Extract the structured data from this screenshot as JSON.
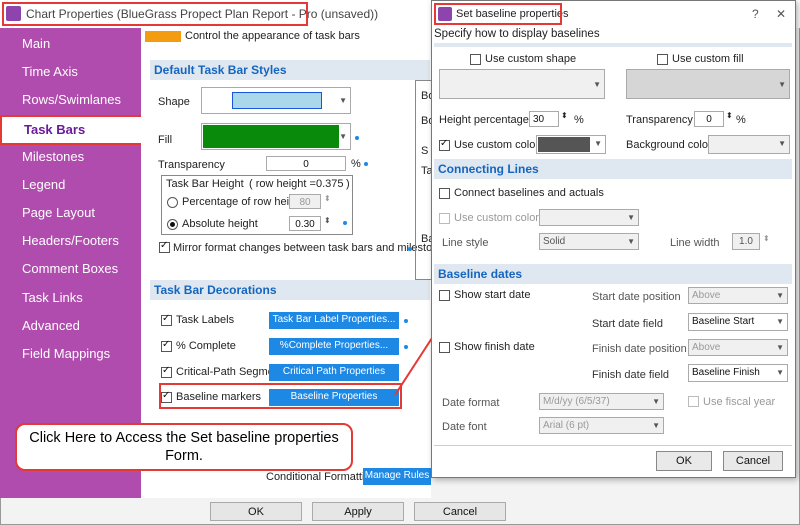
{
  "main_window": {
    "title": "Chart Properties (BlueGrass Propect Plan Report - Pro (unsaved))",
    "top_note": "Control the appearance of task bars",
    "sidebar": [
      {
        "label": "Main"
      },
      {
        "label": "Time Axis"
      },
      {
        "label": "Rows/Swimlanes"
      },
      {
        "label": "Task Bars"
      },
      {
        "label": "Milestones"
      },
      {
        "label": "Legend"
      },
      {
        "label": "Page Layout"
      },
      {
        "label": "Headers/Footers"
      },
      {
        "label": "Comment Boxes"
      },
      {
        "label": "Task Links"
      },
      {
        "label": "Advanced"
      },
      {
        "label": "Field Mappings"
      }
    ],
    "default_styles": {
      "heading": "Default Task Bar Styles",
      "shape_label": "Shape",
      "fill_label": "Fill",
      "transparency_label": "Transparency",
      "transparency_value": "0",
      "percent": "%",
      "height_group": "Task Bar Height",
      "row_height_note": "( row height =",
      "row_height_value": "0.375",
      "row_height_close": ")",
      "pct_row_label": "Percentage of row height",
      "pct_row_value": "80",
      "abs_label": "Absolute height",
      "abs_value": "0.30",
      "mirror_label": "Mirror format changes between task bars and milestones"
    },
    "decorations": {
      "heading": "Task Bar Decorations",
      "items": [
        {
          "label": "Task Labels",
          "button": "Task Bar Label Properties..."
        },
        {
          "label": "% Complete",
          "button": "%Complete Properties..."
        },
        {
          "label": "Critical-Path Segments",
          "button": "Critical Path Properties"
        },
        {
          "label": "Baseline markers",
          "button": "Baseline Properties"
        }
      ]
    },
    "conditional_label": "Conditional Formatting",
    "manage_rules": "Manage Rules",
    "partial_labels": [
      "Bo",
      "Bo",
      "S",
      "Ta",
      "Ba"
    ],
    "callout": "Click Here to Access the Set baseline properties Form.",
    "buttons": {
      "ok": "OK",
      "apply": "Apply",
      "cancel": "Cancel"
    }
  },
  "dialog": {
    "title": "Set baseline properties",
    "subtitle": "Specify how to display baselines",
    "use_custom_shape": "Use custom shape",
    "use_custom_fill": "Use custom fill",
    "height_pct_label": "Height percentage",
    "height_pct_value": "30",
    "percent": "%",
    "transparency_label": "Transparency",
    "transparency_value": "0",
    "use_custom_color": "Use custom color",
    "background_color": "Background color",
    "connecting_heading": "Connecting Lines",
    "connect_label": "Connect baselines and actuals",
    "use_custom_color_2": "Use custom color",
    "line_style_label": "Line style",
    "line_style_value": "Solid",
    "line_width_label": "Line width",
    "line_width_value": "1.0",
    "dates_heading": "Baseline dates",
    "show_start": "Show start date",
    "start_pos_label": "Start date position",
    "start_pos_value": "Above",
    "start_field_label": "Start date field",
    "start_field_value": "Baseline Start",
    "show_finish": "Show finish date",
    "finish_pos_label": "Finish date position",
    "finish_pos_value": "Above",
    "finish_field_label": "Finish date field",
    "finish_field_value": "Baseline Finish",
    "date_format_label": "Date format",
    "date_format_value": "M/d/yy (6/5/37)",
    "use_fiscal": "Use fiscal year",
    "date_font_label": "Date font",
    "date_font_value": "Arial (6 pt)",
    "ok": "OK",
    "cancel": "Cancel"
  },
  "colors": {
    "accent": "#b04cad",
    "highlight": "#e53935",
    "blue": "#1e88e5",
    "fill_green": "#0a8a0a"
  }
}
